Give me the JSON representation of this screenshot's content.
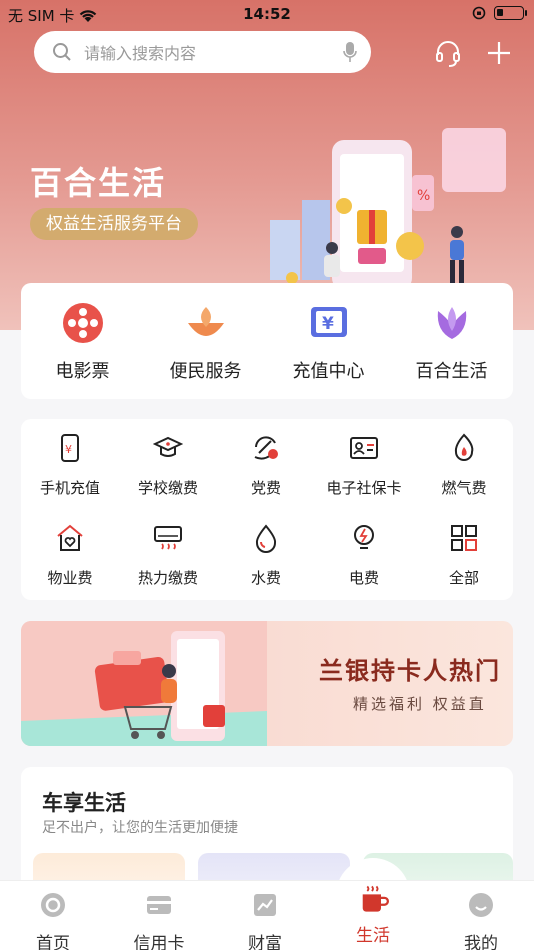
{
  "status_bar": {
    "carrier": "无 SIM 卡",
    "time": "14:52"
  },
  "search": {
    "placeholder": "请输入搜索内容"
  },
  "hero": {
    "title": "百合生活",
    "subtitle": "权益生活服务平台"
  },
  "quick_entries": [
    {
      "label": "电影票",
      "icon": "film-reel-icon"
    },
    {
      "label": "便民服务",
      "icon": "lotus-bowl-icon"
    },
    {
      "label": "充值中心",
      "icon": "yuan-recharge-icon"
    },
    {
      "label": "百合生活",
      "icon": "lily-flower-icon"
    }
  ],
  "services": [
    {
      "label": "手机充值",
      "icon": "phone-recharge-icon"
    },
    {
      "label": "学校缴费",
      "icon": "graduation-cap-icon"
    },
    {
      "label": "党费",
      "icon": "party-fee-icon"
    },
    {
      "label": "电子社保卡",
      "icon": "id-card-icon"
    },
    {
      "label": "燃气费",
      "icon": "flame-icon"
    },
    {
      "label": "物业费",
      "icon": "house-heart-icon"
    },
    {
      "label": "热力缴费",
      "icon": "heater-icon"
    },
    {
      "label": "水费",
      "icon": "water-drop-icon"
    },
    {
      "label": "电费",
      "icon": "lightbulb-icon"
    },
    {
      "label": "全部",
      "icon": "grid-icon"
    }
  ],
  "banner": {
    "title": "兰银持卡人热门",
    "subtitle": "精选福利 权益直"
  },
  "car_section": {
    "title": "车享生活",
    "subtitle": "足不出户，让您的生活更加便捷"
  },
  "tabbar": [
    {
      "label": "首页",
      "icon": "home-swirl-icon",
      "active": false
    },
    {
      "label": "信用卡",
      "icon": "credit-card-icon",
      "active": false
    },
    {
      "label": "财富",
      "icon": "wealth-chart-icon",
      "active": false
    },
    {
      "label": "生活",
      "icon": "coffee-cup-icon",
      "active": true
    },
    {
      "label": "我的",
      "icon": "profile-face-icon",
      "active": false
    }
  ],
  "colors": {
    "accent": "#d1372c",
    "hero": "#d77268",
    "pill": "#d3ab6e"
  }
}
